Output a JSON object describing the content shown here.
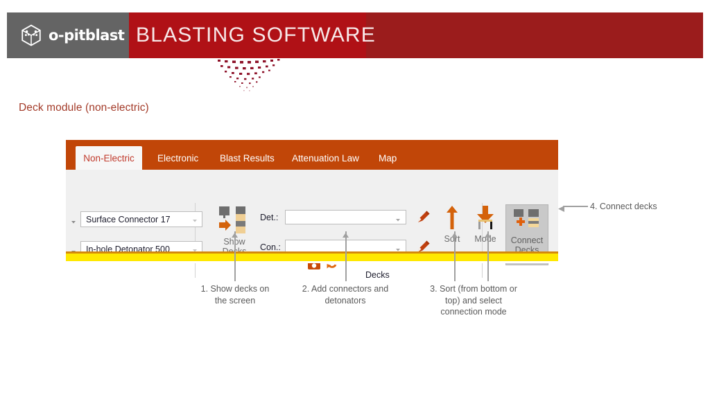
{
  "header": {
    "brand_name": "o-pitblast",
    "brand_logo_icon": "hexagon-cube-logo-icon",
    "title": "BLASTING SOFTWARE",
    "decor_icon": "dotted-spray-graphic",
    "colors": {
      "gray_band": "#646464",
      "bright_red": "#b01116",
      "dark_red": "#9b1c1c",
      "title_text": "#f7e9e9"
    }
  },
  "section": {
    "heading": "Deck module (non-electric)",
    "heading_color": "#a33a28"
  },
  "app": {
    "tabs": [
      {
        "label": "Non-Electric",
        "active": true
      },
      {
        "label": "Electronic",
        "active": false
      },
      {
        "label": "Blast Results",
        "active": false
      },
      {
        "label": "Attenuation Law",
        "active": false
      },
      {
        "label": "Map",
        "active": false
      }
    ],
    "tabstrip_color": "#c14608",
    "active_tab_text_color": "#c0392b",
    "left_group": {
      "combo_surface": {
        "value": "Surface Connector 17",
        "expand_icon": "caret-down-icon",
        "side_icon": "caret-down-icon"
      },
      "combo_inhole": {
        "value": "In-hole Detonator 500",
        "expand_icon": "caret-down-icon",
        "side_icon": "caret-down-icon"
      }
    },
    "show_decks": {
      "caption_line1": "Show",
      "caption_line2": "Decks",
      "icon": "show-decks-icon"
    },
    "decks_group": {
      "group_label": "Decks",
      "det_label": "Det.:",
      "det_value": "",
      "det_placeholder": "",
      "con_label": "Con.:",
      "con_value": "",
      "con_placeholder": "",
      "det_edit_icon": "pencil-icon",
      "con_edit_icon": "pencil-icon",
      "save_icon": "save-floppy-icon",
      "refresh_icon": "refresh-icon"
    },
    "sort": {
      "caption": "Sort",
      "icon": "sort-up-arrow-icon",
      "menu_icon": "caret-down-icon"
    },
    "mode": {
      "caption": "Mode",
      "icon": "mode-down-arrow-icon",
      "menu_icon": "caret-down-icon"
    },
    "connect_decks": {
      "caption_line1": "Connect",
      "caption_line2": "Decks",
      "icon": "connect-decks-icon",
      "pressed": true
    },
    "status_bar_color": "#ffe800"
  },
  "callouts": [
    {
      "id": "1",
      "text_line1": "1. Show decks on",
      "text_line2": "the screen",
      "text_line3": ""
    },
    {
      "id": "2",
      "text_line1": "2. Add connectors and",
      "text_line2": "detonators",
      "text_line3": ""
    },
    {
      "id": "3",
      "text_line1": "3. Sort (from bottom or",
      "text_line2": "top) and select",
      "text_line3": "connection mode"
    },
    {
      "id": "4",
      "text_line1": "4. Connect decks",
      "text_line2": "",
      "text_line3": ""
    }
  ]
}
